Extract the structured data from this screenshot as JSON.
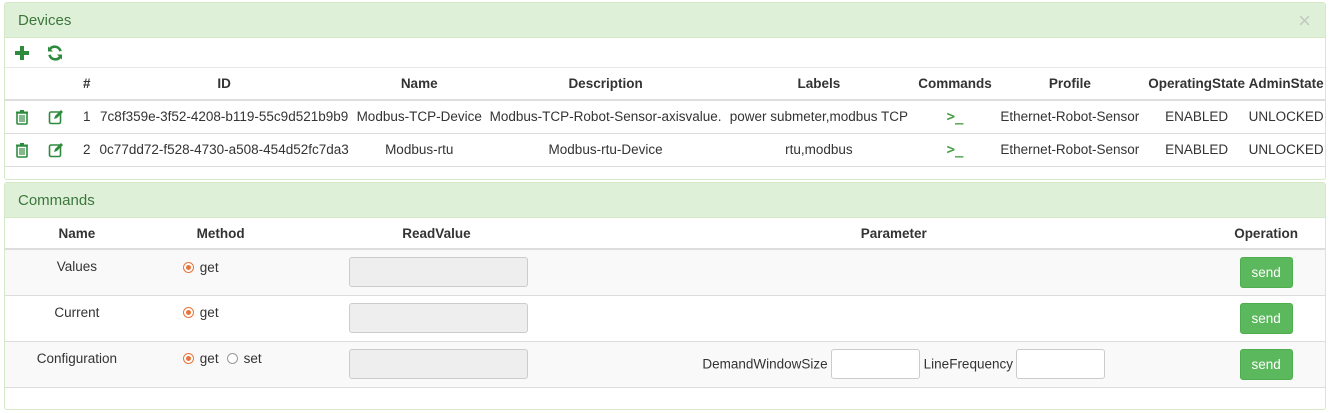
{
  "devices_panel": {
    "title": "Devices",
    "close_glyph": "×",
    "toolbar": {
      "add_icon": "plus-icon",
      "refresh_icon": "refresh-icon"
    },
    "columns": [
      "#",
      "ID",
      "Name",
      "Description",
      "Labels",
      "Commands",
      "Profile",
      "OperatingState",
      "AdminState"
    ],
    "rows": [
      {
        "num": "1",
        "id": "7c8f359e-3f52-4208-b119-55c9d521b9b9",
        "name": "Modbus-TCP-Device",
        "description": "Modbus-TCP-Robot-Sensor-axisvalue.",
        "labels": "power submeter,modbus TCP",
        "commands": ">_",
        "profile": "Ethernet-Robot-Sensor",
        "operating_state": "ENABLED",
        "admin_state": "UNLOCKED"
      },
      {
        "num": "2",
        "id": "0c77dd72-f528-4730-a508-454d52fc7da3",
        "name": "Modbus-rtu",
        "description": "Modbus-rtu-Device",
        "labels": "rtu,modbus",
        "commands": ">_",
        "profile": "Ethernet-Robot-Sensor",
        "operating_state": "ENABLED",
        "admin_state": "UNLOCKED"
      }
    ]
  },
  "commands_panel": {
    "title": "Commands",
    "columns": [
      "Name",
      "Method",
      "ReadValue",
      "Parameter",
      "Operation"
    ],
    "rows": [
      {
        "name": "Values",
        "method_get": "get",
        "send_label": "send"
      },
      {
        "name": "Current",
        "method_get": "get",
        "send_label": "send"
      },
      {
        "name": "Configuration",
        "method_get": "get",
        "method_set": "set",
        "param1_label": "DemandWindowSize",
        "param2_label": "LineFrequency",
        "send_label": "send"
      }
    ]
  },
  "colors": {
    "accent_green": "#5cb85c",
    "heading_bg": "#dff0d8",
    "heading_text": "#3c763d",
    "radio_checked": "#e8743b"
  }
}
